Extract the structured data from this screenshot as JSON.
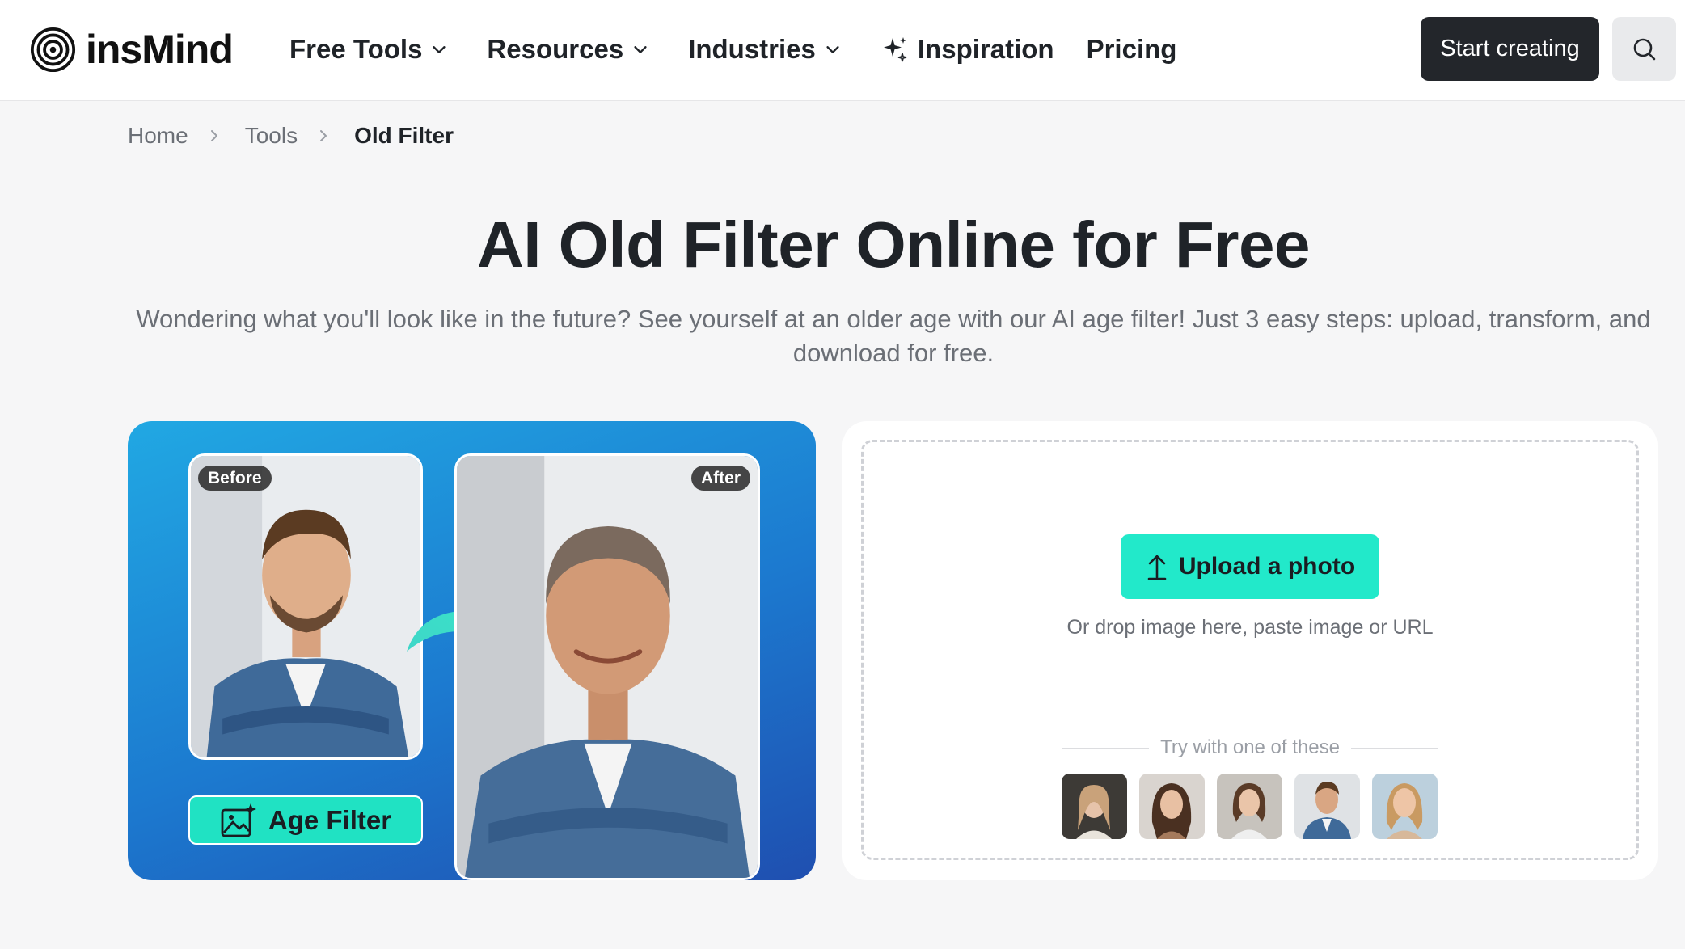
{
  "brand": {
    "name": "insMind"
  },
  "nav": {
    "items": [
      {
        "label": "Free Tools",
        "icon": "chevron-down-icon"
      },
      {
        "label": "Resources",
        "icon": "chevron-down-icon"
      },
      {
        "label": "Industries",
        "icon": "chevron-down-icon"
      },
      {
        "label": "Inspiration",
        "icon": "sparkle-icon"
      },
      {
        "label": "Pricing"
      }
    ],
    "cta_label": "Start creating",
    "search_icon": "search-icon"
  },
  "breadcrumb": [
    "Home",
    "Tools",
    "Old Filter"
  ],
  "hero": {
    "title": "AI Old Filter Online for Free",
    "subtitle": "Wondering what you'll look like in the future? See yourself at an older age with our AI age filter! Just 3 easy steps: upload, transform, and download for free."
  },
  "demo": {
    "before_label": "Before",
    "after_label": "After",
    "filter_button": "Age Filter"
  },
  "upload": {
    "button_label": "Upload a photo",
    "hint": "Or drop image here, paste image or URL",
    "try_label": "Try with one of these"
  },
  "colors": {
    "accent": "#22e9ca",
    "dark_button": "#23262b",
    "card_gradient_start": "#21a8e3",
    "card_gradient_end": "#1f4fb0"
  }
}
